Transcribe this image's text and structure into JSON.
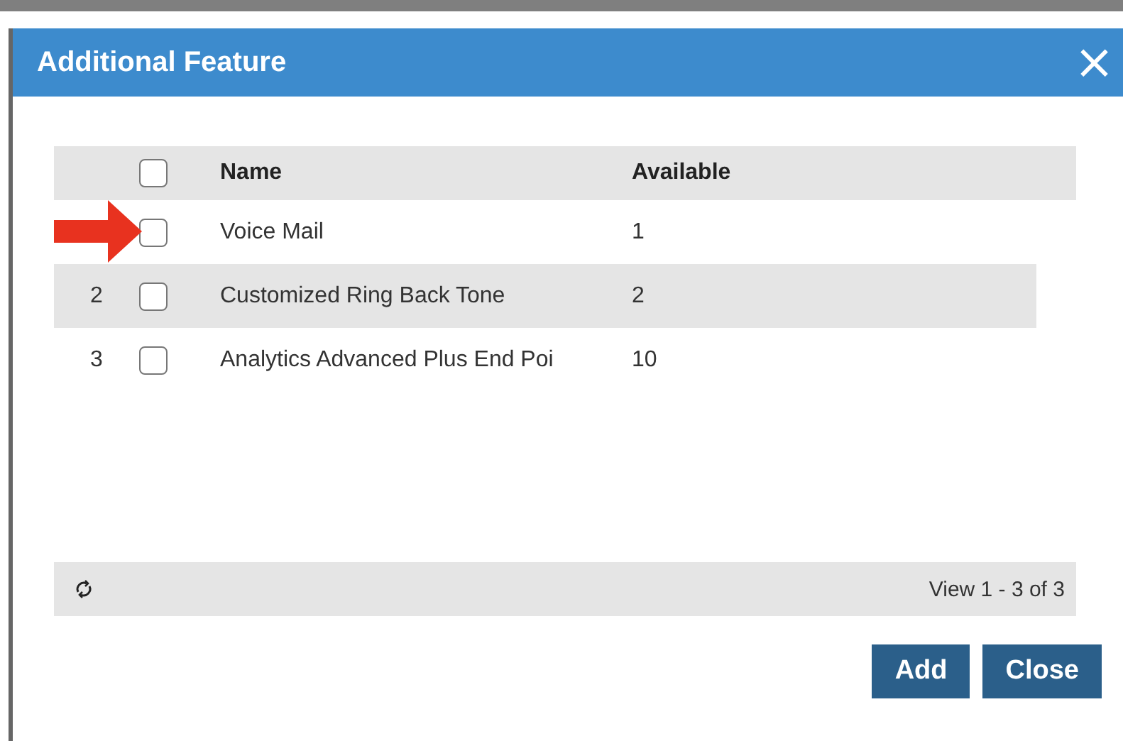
{
  "dialog": {
    "title": "Additional Feature",
    "close_glyph": "×"
  },
  "table": {
    "columns": [
      "Name",
      "Available"
    ],
    "header_checked": false,
    "rows": [
      {
        "number": "",
        "checked": false,
        "highlighted": false,
        "name": "Voice Mail",
        "available": "1",
        "pointed": true
      },
      {
        "number": "2",
        "checked": false,
        "highlighted": true,
        "name": "Customized Ring Back Tone",
        "available": "2",
        "pointed": false
      },
      {
        "number": "3",
        "checked": false,
        "highlighted": false,
        "name": "Analytics Advanced Plus End Poi",
        "available": "10",
        "pointed": false
      }
    ]
  },
  "pager": {
    "text": "View 1 - 3 of 3"
  },
  "buttons": [
    "Add",
    "Close"
  ]
}
